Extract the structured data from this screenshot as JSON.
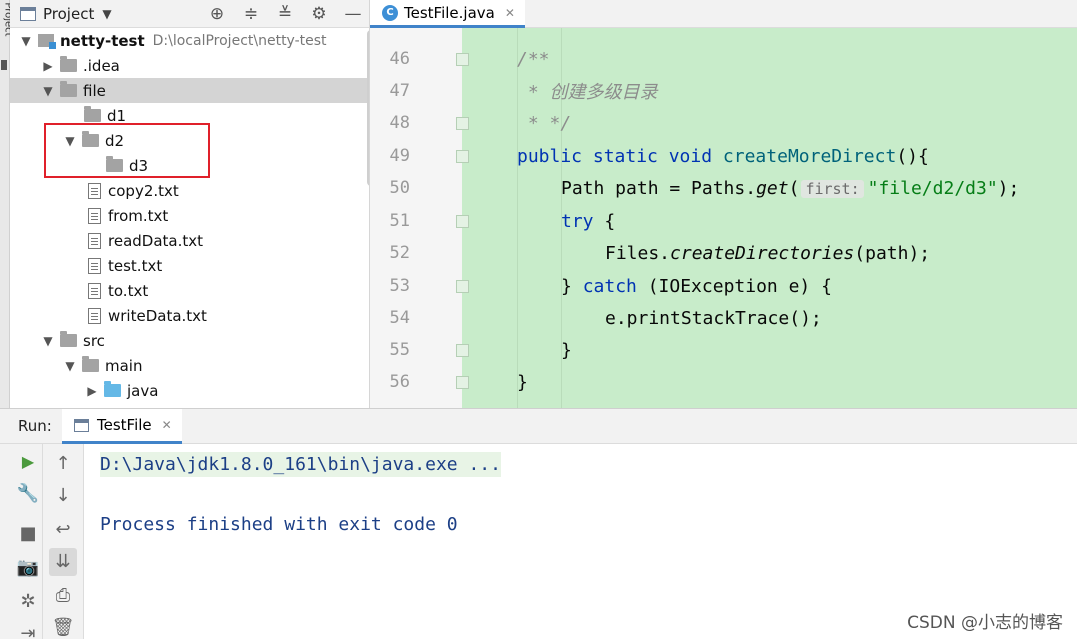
{
  "tool_strip": {
    "label": "Project"
  },
  "project_panel": {
    "title": "Project",
    "header_icons": [
      "crosshair-icon",
      "expand-all-icon",
      "collapse-all-icon",
      "gear-icon",
      "minimize-icon"
    ],
    "tree": [
      {
        "label": "netty-test",
        "path": "D:\\localProject\\netty-test",
        "type": "module",
        "expanded": true
      },
      {
        "label": ".idea",
        "type": "folder",
        "expanded": false
      },
      {
        "label": "file",
        "type": "folder",
        "expanded": true,
        "selected": true
      },
      {
        "label": "d1",
        "type": "folder"
      },
      {
        "label": "d2",
        "type": "folder",
        "expanded": true
      },
      {
        "label": "d3",
        "type": "folder"
      },
      {
        "label": "copy2.txt",
        "type": "file"
      },
      {
        "label": "from.txt",
        "type": "file"
      },
      {
        "label": "readData.txt",
        "type": "file"
      },
      {
        "label": "test.txt",
        "type": "file"
      },
      {
        "label": "to.txt",
        "type": "file"
      },
      {
        "label": "writeData.txt",
        "type": "file"
      },
      {
        "label": "src",
        "type": "folder",
        "expanded": true
      },
      {
        "label": "main",
        "type": "folder",
        "expanded": true
      },
      {
        "label": "java",
        "type": "folder-source",
        "expanded": false
      }
    ]
  },
  "editor": {
    "tab_label": "TestFile.java",
    "tab_icon": "C",
    "lines": [
      {
        "num": "46",
        "text": "/**"
      },
      {
        "num": "47",
        "text": " * 创建多级目录"
      },
      {
        "num": "48",
        "text": " * */"
      },
      {
        "num": "49",
        "kw": "public static void",
        "fn": "createMoreDirect",
        "rest": "(){"
      },
      {
        "num": "50",
        "a": "Path path = Paths.",
        "m": "get",
        "b": "(",
        "hint": "first:",
        "str": "\"file/d2/d3\"",
        "c": ");"
      },
      {
        "num": "51",
        "kw": "try",
        "rest": " {"
      },
      {
        "num": "52",
        "a": "Files.",
        "m": "createDirectories",
        "b": "(path);"
      },
      {
        "num": "53",
        "a": "} ",
        "kw": "catch",
        "b": " (IOException e) {"
      },
      {
        "num": "54",
        "text": "e.printStackTrace();"
      },
      {
        "num": "55",
        "text": "}"
      },
      {
        "num": "56",
        "text": "}"
      }
    ]
  },
  "run_panel": {
    "label": "Run:",
    "tab_label": "TestFile",
    "console_lines": [
      "D:\\Java\\jdk1.8.0_161\\bin\\java.exe ...",
      "Process finished with exit code 0"
    ],
    "left_toolbar": [
      "run-icon",
      "wrench-icon",
      "stop-icon",
      "camera-icon",
      "settings-icon",
      "exit-icon"
    ],
    "right_toolbar": [
      "up-arrow-icon",
      "down-arrow-icon",
      "soft-wrap-icon",
      "scroll-to-end-icon",
      "print-icon",
      "trash-icon"
    ]
  },
  "watermark": "CSDN @小志的博客"
}
